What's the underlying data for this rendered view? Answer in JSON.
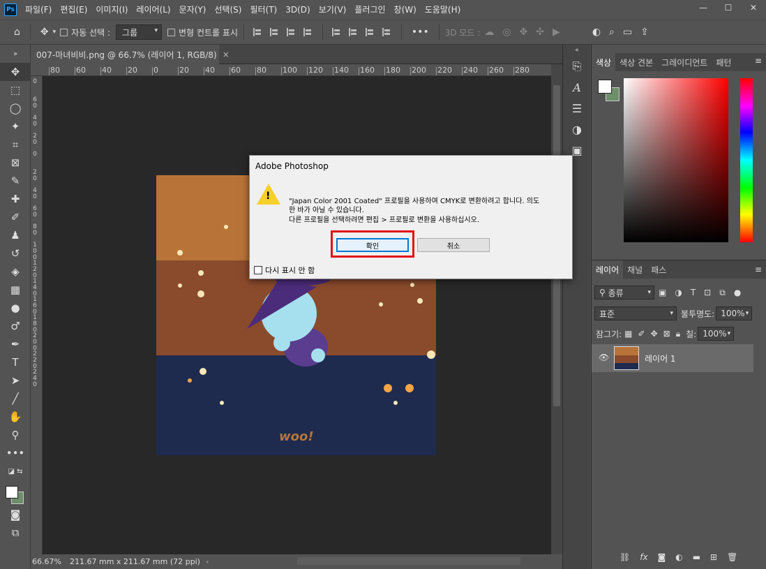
{
  "app": {
    "logo": "Ps"
  },
  "menu": [
    "파일(F)",
    "편집(E)",
    "이미지(I)",
    "레이어(L)",
    "문자(Y)",
    "선택(S)",
    "필터(T)",
    "3D(D)",
    "보기(V)",
    "플러그인",
    "창(W)",
    "도움말(H)"
  ],
  "window_buttons": {
    "minimize": "—",
    "maximize": "☐",
    "close": "✕"
  },
  "options": {
    "auto_select_label": "자동 선택 :",
    "auto_select_value": "그룹",
    "transform_label": "변형 컨트롤 표시",
    "more": "•••",
    "mode_3d_label": "3D 모드 :"
  },
  "document": {
    "tab_title": "007-마녀비비.png @ 66.7% (레이어 1, RGB/8)",
    "tab_close": "×",
    "zoom": "66.67%",
    "doc_size": "211.67 mm x 211.67 mm (72 ppi)"
  },
  "ruler": {
    "h_ticks": [
      "80",
      "60",
      "40",
      "20",
      "0",
      "20",
      "40",
      "60",
      "80",
      "100",
      "120",
      "140",
      "160",
      "180",
      "200",
      "220",
      "240",
      "260",
      "280"
    ],
    "v_ticks": [
      "0",
      "6 0",
      "4 0",
      "2 0",
      "0",
      "2 0",
      "4 0",
      "6 0",
      "8 0",
      "1 0 0",
      "1 2 0",
      "1 4 0",
      "1 6 0",
      "1 8 0",
      "2 0 0",
      "2 2 0",
      "2 4 0"
    ]
  },
  "artwork": {
    "top_color": "#b87438",
    "mid_color": "#8a4a2c",
    "bottom_color": "#1e2b4e",
    "signature": "woo!"
  },
  "color_panel": {
    "tabs": [
      "색상",
      "색상 견본",
      "그레이디언트",
      "패턴"
    ],
    "fg": "#ffffff",
    "bg": "#6e8e6c"
  },
  "layers_panel": {
    "tabs": [
      "레이어",
      "채널",
      "패스"
    ],
    "filter_kind": "종류",
    "blend_mode": "표준",
    "opacity_label": "불투명도:",
    "opacity_value": "100%",
    "lock_label": "잠그기:",
    "fill_label": "칠:",
    "fill_value": "100%",
    "layer_name": "레이어 1"
  },
  "dialog": {
    "title": "Adobe Photoshop",
    "line1": "\"Japan Color 2001 Coated\" 프로필을 사용하여 CMYK로 변환하려고 합니다. 의도",
    "line2": "한 바가 아닐 수 있습니다.",
    "line3": "다른 프로필을 선택하려면 편집 > 프로필로 변환을 사용하십시오.",
    "ok": "확인",
    "cancel": "취소",
    "dont_show": "다시 표시 안 함"
  }
}
